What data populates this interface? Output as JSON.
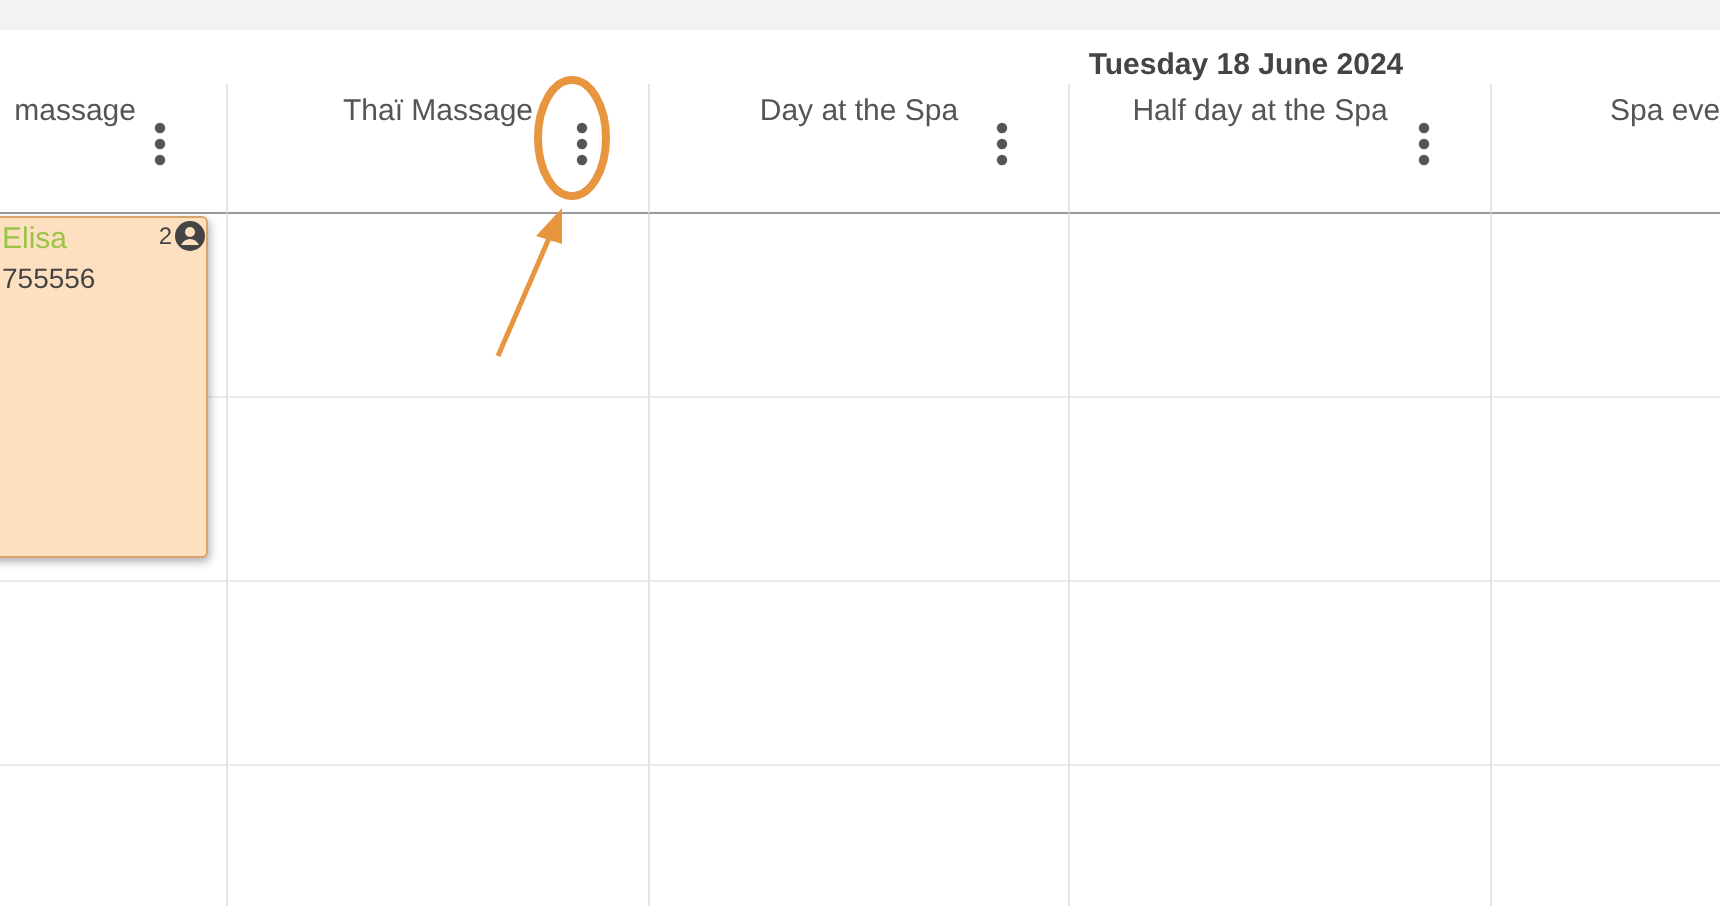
{
  "date_title": "Tuesday 18 June 2024",
  "columns": [
    {
      "label": "massage"
    },
    {
      "label": "Thaï Massage"
    },
    {
      "label": "Day at the Spa"
    },
    {
      "label": "Half day at the Spa"
    },
    {
      "label": "Spa eve"
    }
  ],
  "appointments": [
    {
      "name": "Elisa",
      "phone": "755556",
      "count": "2"
    }
  ]
}
